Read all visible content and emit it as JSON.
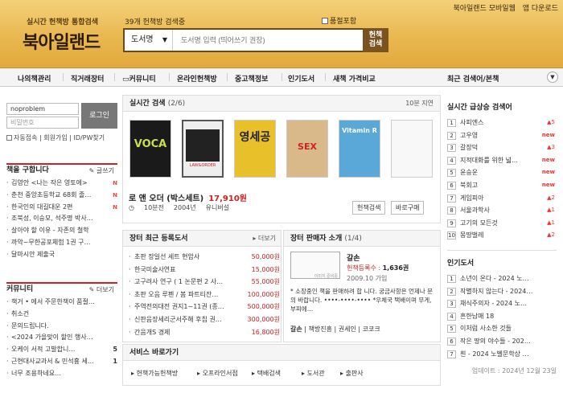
{
  "header": {
    "tagline": "실시간 헌책방 통합검색",
    "logo": "북아일랜드",
    "count_text": "39개 헌책방 검색중",
    "check_label": "품절포함",
    "search_select": "도서명",
    "search_placeholder": "도서명 입력 (띄어쓰기 권장)",
    "search_button": "헌책\n검색",
    "top_links": [
      "북아일랜드 모바일웹",
      "앱 다운로드"
    ]
  },
  "nav": {
    "items": [
      "나의책관리",
      "직거래장터",
      "커뮤니티",
      "온라인헌책방",
      "중고책정보",
      "인기도서",
      "새책 가격비교"
    ],
    "right": "최근 검색어/본책"
  },
  "login": {
    "id_value": "noproblem",
    "pw_placeholder": "비밀번호",
    "button": "로그인",
    "options": [
      "자동접속",
      "회원가입",
      "ID/PW찾기"
    ]
  },
  "wanted": {
    "title": "책을 구합니다",
    "more": "글쓰기",
    "items": [
      {
        "text": "김영안 <나는 작은 영토에>",
        "badge": "N"
      },
      {
        "text": "춘천 중앙초등학교 68회 졸…",
        "badge": "N"
      },
      {
        "text": "한국인의 대길대운 2편",
        "badge": "N"
      },
      {
        "text": "조북성, 이승모, 석주명 박사…",
        "badge": ""
      },
      {
        "text": "살아야 할 이유 - 자존의 철학",
        "badge": ""
      },
      {
        "text": "까악~무한공포체험 1권 구…",
        "badge": ""
      },
      {
        "text": "달마시안 제출국",
        "badge": ""
      }
    ]
  },
  "community": {
    "title": "커뮤니티",
    "more": "더보기",
    "items": [
      {
        "text": "책거 • 에서 주문한책이 품절…",
        "count": ""
      },
      {
        "text": "취소건",
        "count": ""
      },
      {
        "text": "문의드립니다.",
        "count": ""
      },
      {
        "text": "<2024 가을맞이 할인 행사…",
        "count": ""
      },
      {
        "text": "오케이 서적 고발합니…",
        "count": "5"
      },
      {
        "text": "근현대사교과서 & 민석흉 세…",
        "count": "1"
      },
      {
        "text": "너무 조용하네요…",
        "count": ""
      }
    ]
  },
  "realtime": {
    "title": "실시간 검색",
    "page": "(2/6)",
    "delay": "10분 지연",
    "book_title": "로 앤 오더 (박스세트)",
    "book_price": "17,910원",
    "meta": [
      "10분전",
      "2004년",
      "유니버설"
    ],
    "buttons": [
      "헌책검색",
      "바로구매"
    ],
    "covers": [
      {
        "bg": "#1a1a1a",
        "label": "VOCA"
      },
      {
        "bg": "#eeeeee",
        "label": "LAW&ORDER"
      },
      {
        "bg": "#e8c02a",
        "label": "영세공"
      },
      {
        "bg": "#d9b98a",
        "label": "SEX"
      },
      {
        "bg": "#5aa8d8",
        "label": "Vitamin R"
      },
      {
        "bg": "#f8f8f8",
        "label": ""
      }
    ]
  },
  "registered": {
    "title": "장터 최근 등록도서",
    "more": "더보기",
    "items": [
      {
        "title": "초판 장일선 세트 현암사",
        "price": "50,000원"
      },
      {
        "title": "한국미술사연표",
        "price": "15,000원"
      },
      {
        "title": "고구려사 연구 ( 1 논문편 2 사…",
        "price": "55,000원"
      },
      {
        "title": "초판 오음 루펜 / 봄 파트티잔…",
        "price": "100,000원"
      },
      {
        "title": "주역전의대전 권지1~11권 (종…",
        "price": "500,000원"
      },
      {
        "title": "신판음장세리군서주해 후칩 권…",
        "price": "300,000원"
      },
      {
        "title": "간음개S 경제",
        "price": "16,800원"
      }
    ]
  },
  "seller": {
    "title": "장터 판매자 소개",
    "page": "(1/4)",
    "name": "갈손",
    "score_label": "헌책등록수 :",
    "score": "1,636권",
    "date": "2009.10 가입",
    "photo_label": "이미지 준비중",
    "desc": "* 소장중인 책을 판매하려 합 니다. 궁금사항은 언제나 문의 바랍니다. ••••-••••-•••• *우체국 택배이며 무게,부피에…",
    "links": [
      "갈손",
      "책방진흥",
      "권세인",
      "코코크"
    ]
  },
  "service": {
    "title": "서비스 바로가기",
    "items": [
      "헌책가능헌책방",
      "오프라인서점",
      "택배검색",
      "도서관",
      "출판사"
    ]
  },
  "hot": {
    "title": "실시간 급상승 검색어",
    "items": [
      {
        "text": "사피엔스",
        "change": "5"
      },
      {
        "text": "고우영",
        "change": "new"
      },
      {
        "text": "갈장덕",
        "change": "3"
      },
      {
        "text": "지적대화를 위한 넓…",
        "change": "new"
      },
      {
        "text": "윤승운",
        "change": "new"
      },
      {
        "text": "북회고",
        "change": "new"
      },
      {
        "text": "게임피아",
        "change": "2"
      },
      {
        "text": "서울과학사",
        "change": "1"
      },
      {
        "text": "고기의 모든것",
        "change": "1"
      },
      {
        "text": "몽땅벌레",
        "change": "2"
      }
    ]
  },
  "popular": {
    "title": "인기도서",
    "items": [
      "소년이 온다 - 2024 노…",
      "작별하지 않는다 - 2024…",
      "채식주의자 - 2024 노…",
      "흔한남매 18",
      "이처럼 사소한 것들",
      "작은 땅의 야수들 - 202…",
      "흰 - 2024 노벨문학상 …"
    ],
    "updated": "업데이트 : 2024년 12월 23일"
  },
  "colors": {
    "accent": "#c22222",
    "header": "#e9b84f"
  }
}
